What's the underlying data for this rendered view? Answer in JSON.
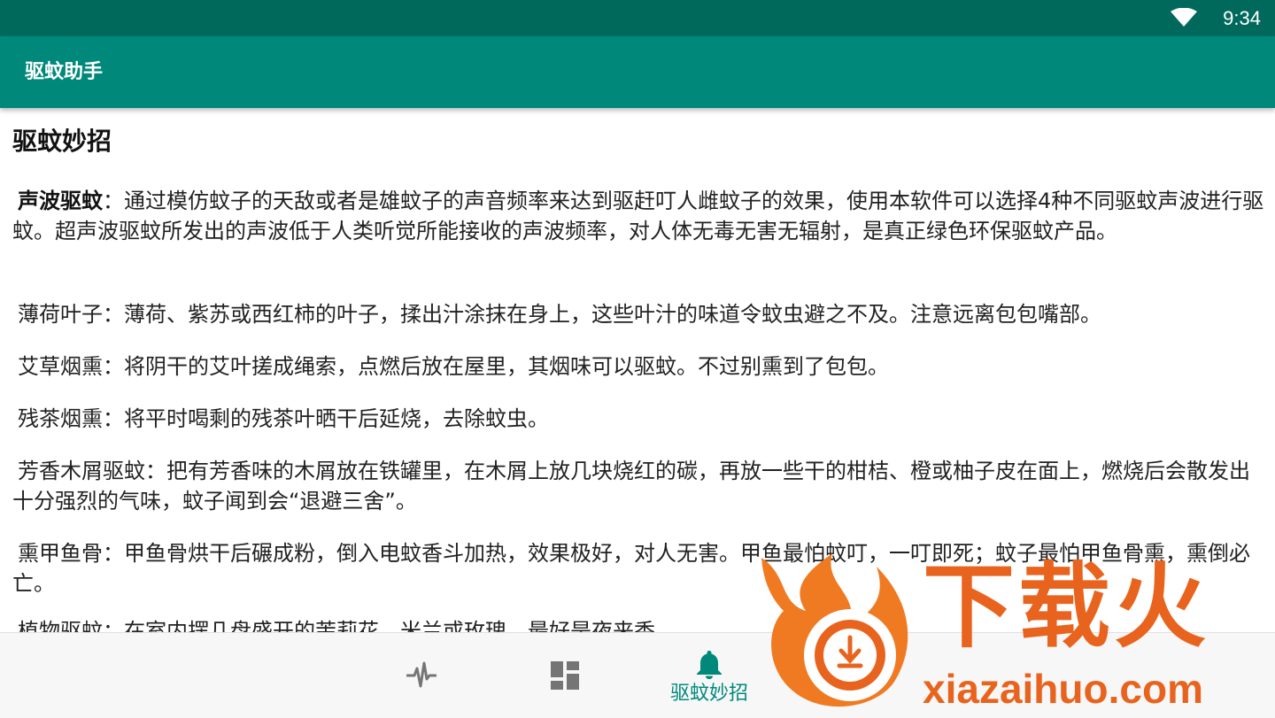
{
  "status_bar": {
    "time": "9:34",
    "icons": [
      "wifi-icon"
    ]
  },
  "app_bar": {
    "title": "驱蚊助手"
  },
  "content": {
    "heading": "驱蚊妙招",
    "paragraphs": [
      {
        "title": "声波驱蚊",
        "body": "：通过模仿蚊子的天敌或者是雄蚊子的声音频率来达到驱赶叮人雌蚊子的效果，使用本软件可以选择4种不同驱蚊声波进行驱蚊。超声波驱蚊所发出的声波低于人类听觉所能接收的声波频率，对人体无毒无害无辐射，是真正绿色环保驱蚊产品。"
      },
      {
        "title": "薄荷叶子",
        "body": "：薄荷、紫苏或西红柿的叶子，揉出汁涂抹在身上，这些叶汁的味道令蚊虫避之不及。注意远离包包嘴部。"
      },
      {
        "title": "艾草烟熏",
        "body": "：将阴干的艾叶搓成绳索，点燃后放在屋里，其烟味可以驱蚊。不过别熏到了包包。"
      },
      {
        "title": "残茶烟熏",
        "body": "：将平时喝剩的残茶叶晒干后延烧，去除蚊虫。"
      },
      {
        "title": "芳香木屑驱蚊",
        "body": "：把有芳香味的木屑放在铁罐里，在木屑上放几块烧红的碳，再放一些干的柑桔、橙或柚子皮在面上，燃烧后会散发出十分强烈的气味，蚊子闻到会“退避三舍”。"
      },
      {
        "title": "熏甲鱼骨",
        "body": "：甲鱼骨烘干后碾成粉，倒入电蚊香斗加热，效果极好，对人无害。甲鱼最怕蚊叮，一叮即死；蚊子最怕甲鱼骨熏，熏倒必亡。"
      },
      {
        "title": "植物驱蚊",
        "body": "：在室内摆几盘盛开的茉莉花、米兰或玫瑰，最好是夜来香，"
      }
    ]
  },
  "bottom_nav": {
    "items": [
      {
        "icon": "pulse-icon",
        "label": ""
      },
      {
        "icon": "dashboard-icon",
        "label": ""
      },
      {
        "icon": "bell-icon",
        "label": "驱蚊妙招"
      }
    ],
    "accent": "#00897b"
  },
  "watermark": {
    "text": "下载火",
    "url": "xiazaihuo.com",
    "color": "#e8641e"
  },
  "colors": {
    "status_bar": "#00695c",
    "app_bar": "#00897b"
  }
}
